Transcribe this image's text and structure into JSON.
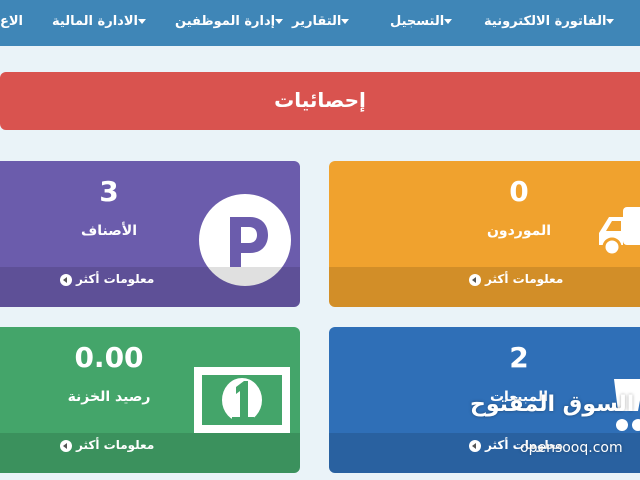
{
  "nav": {
    "items": [
      {
        "label": "الفاتورة الالكترونية"
      },
      {
        "label": "التسجيل"
      },
      {
        "label": "التقارير"
      },
      {
        "label": "إدارة الموظفين"
      },
      {
        "label": "الادارة المالية"
      },
      {
        "label": "الاع"
      }
    ]
  },
  "banner": {
    "title": "إحصائيات"
  },
  "cards": {
    "suppliers": {
      "value": "0",
      "label": "الموردون",
      "more": "معلومات أكثر",
      "color": "#f0a22e",
      "icon": "truck-icon"
    },
    "categories": {
      "value": "3",
      "label": "الأصناف",
      "more": "معلومات أكثر",
      "color": "#6b5cac",
      "icon": "parking-icon"
    },
    "sales": {
      "value": "2",
      "label": "المبيعات",
      "more": "معلومات أكثر",
      "color": "#2f6fb7",
      "icon": "shopping-cart-icon"
    },
    "treasury": {
      "value": "0.00",
      "label": "رصيد الخزنة",
      "more": "معلومات أكثر",
      "color": "#44a56a",
      "icon": "banknote-icon"
    }
  },
  "watermark": {
    "text": "السوق المفتوح",
    "sub": "opensooq.com",
    "brand": "opensooq"
  }
}
